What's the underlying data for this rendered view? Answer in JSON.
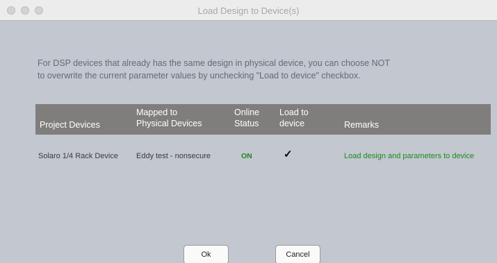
{
  "window": {
    "title": "Load Design to Device(s)"
  },
  "description": {
    "line1": "For DSP devices that already has the same design in physical device, you can choose NOT",
    "line2": "to overwrite the current parameter values by unchecking \"Load to device\" checkbox."
  },
  "table": {
    "headers": {
      "project_devices": "Project Devices",
      "mapped_line1": "Mapped to",
      "mapped_line2": "Physical Devices",
      "online_line1": "Online",
      "online_line2": "Status",
      "load_line1": "Load to",
      "load_line2": "device",
      "remarks": "Remarks"
    },
    "rows": [
      {
        "project_device": "Solaro 1/4 Rack Device",
        "physical_device": "Eddy test - nonsecure",
        "online_status": "ON",
        "load_to_device": true,
        "remarks": "Load design and parameters to device"
      }
    ]
  },
  "buttons": {
    "ok": "Ok",
    "cancel": "Cancel"
  },
  "colors": {
    "status_on": "#1d8a1d",
    "remarks": "#1d8a1d",
    "header_bg": "#807e7c",
    "window_bg": "#c2c7d0"
  }
}
